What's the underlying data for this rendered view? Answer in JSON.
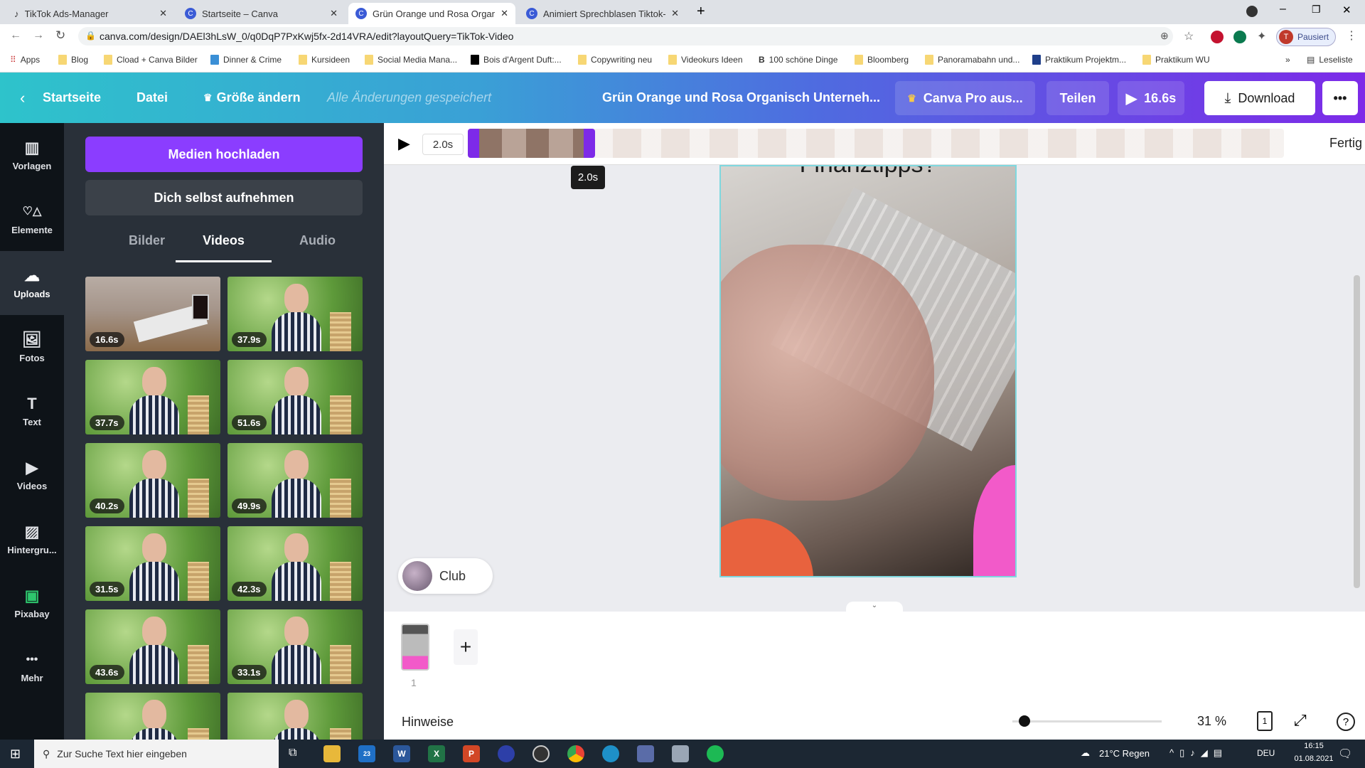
{
  "browser": {
    "tabs": [
      {
        "title": "TikTok Ads-Manager",
        "icon": "tiktok-icon"
      },
      {
        "title": "Startseite – Canva",
        "icon": "canva-icon"
      },
      {
        "title": "Grün Orange und Rosa Organisc",
        "icon": "canva-icon",
        "active": true
      },
      {
        "title": "Animiert Sprechblasen Tiktok-Hi",
        "icon": "canva-icon"
      }
    ],
    "url": "canva.com/design/DAEl3hLsW_0/q0DqP7PxKwj5fx-2d14VRA/edit?layoutQuery=TikTok-Video",
    "profile_label": "Pausiert",
    "profile_initial": "T",
    "bookmarks": [
      "Apps",
      "Blog",
      "Cload + Canva Bilder",
      "Dinner & Crime",
      "Kursideen",
      "Social Media Mana...",
      "Bois d'Argent Duft:...",
      "Copywriting neu",
      "Videokurs Ideen",
      "100 schöne Dinge",
      "Bloomberg",
      "Panoramabahn und...",
      "Praktikum Projektm...",
      "Praktikum WU"
    ],
    "reading_list": "Leseliste"
  },
  "header": {
    "home": "Startseite",
    "file": "Datei",
    "resize": "Größe ändern",
    "saved_status": "Alle Änderungen gespeichert",
    "title": "Grün Orange und Rosa Organisch Unterneh...",
    "pro": "Canva Pro aus...",
    "share": "Teilen",
    "play_duration": "16.6s",
    "download": "Download",
    "more": "•••"
  },
  "rail": [
    {
      "label": "Vorlagen",
      "icon": "▥"
    },
    {
      "label": "Elemente",
      "icon": "♡△"
    },
    {
      "label": "Uploads",
      "icon": "☁",
      "active": true
    },
    {
      "label": "Fotos",
      "icon": "🖼"
    },
    {
      "label": "Text",
      "icon": "T"
    },
    {
      "label": "Videos",
      "icon": "▶"
    },
    {
      "label": "Hintergru...",
      "icon": "▨"
    },
    {
      "label": "Pixabay",
      "icon": "▣"
    },
    {
      "label": "Mehr",
      "icon": "•••"
    }
  ],
  "panel": {
    "upload": "Medien hochladen",
    "record": "Dich selbst aufnehmen",
    "tabs": [
      "Bilder",
      "Videos",
      "Audio"
    ],
    "active_tab": "Videos",
    "videos": [
      "16.6s",
      "37.9s",
      "37.7s",
      "51.6s",
      "40.2s",
      "49.9s",
      "31.5s",
      "42.3s",
      "43.6s",
      "33.1s"
    ]
  },
  "timeline": {
    "duration": "2.0s",
    "tooltip": "2.0s",
    "done": "Fertig"
  },
  "canvas": {
    "page_text": "Finanztipps?",
    "club_label": "Club"
  },
  "pages": {
    "page_number": "1",
    "add": "+"
  },
  "footer": {
    "notes": "Hinweise",
    "zoom": "31 %",
    "zoom_level": 31,
    "page_count": "1",
    "help": "?"
  },
  "taskbar": {
    "search_placeholder": "Zur Suche Text hier eingeben",
    "weather": "21°C  Regen",
    "lang": "DEU",
    "time": "16:15",
    "date": "01.08.2021",
    "mail_badge": "23"
  },
  "colors": {
    "brand_purple": "#8b3dff",
    "header_start": "#2ec3cb",
    "header_end": "#7d2ae8",
    "panel_bg": "#293039",
    "rail_bg": "#0e1318"
  }
}
